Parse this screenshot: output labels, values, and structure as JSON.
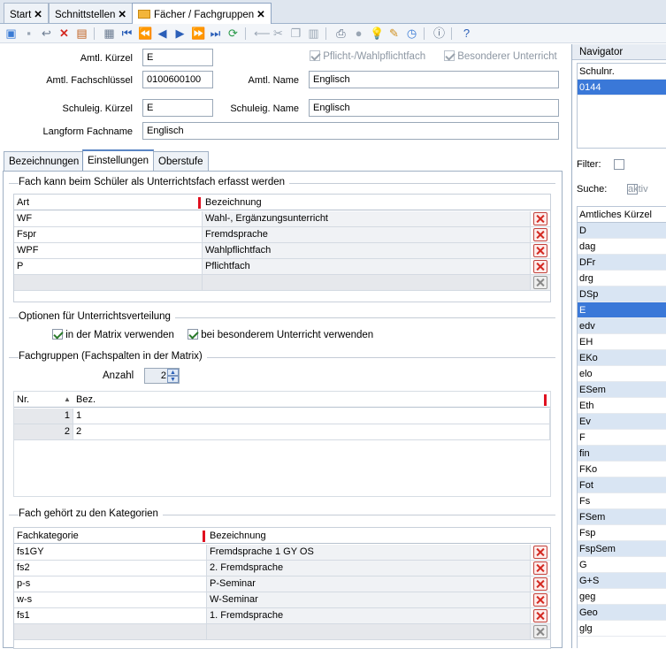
{
  "tabs": [
    {
      "label": "Start",
      "close": "✕"
    },
    {
      "label": "Schnittstellen",
      "close": "✕"
    },
    {
      "label": "Fächer / Fachgruppen",
      "close": "✕"
    }
  ],
  "form": {
    "amtl_kuerzel_label": "Amtl. Kürzel",
    "amtl_kuerzel": "E",
    "amtl_schluessel_label": "Amtl.  Fachschlüssel",
    "amtl_schluessel": "0100600100",
    "amtl_name_label": "Amtl. Name",
    "amtl_name": "Englisch",
    "schul_kuerzel_label": "Schuleig. Kürzel",
    "schul_kuerzel": "E",
    "schul_name_label": "Schuleig. Name",
    "schul_name": "Englisch",
    "langform_label": "Langform Fachname",
    "langform": "Englisch",
    "pflicht_wahl": "Pflicht-/Wahlpflichtfach",
    "besonderer": "Besonderer Unterricht"
  },
  "inner_tabs": [
    "Bezeichnungen",
    "Einstellungen",
    "Oberstufe"
  ],
  "section1": {
    "title": "Fach kann beim Schüler als Unterrichtsfach erfasst werden",
    "headers": [
      "Art",
      "Bezeichnung"
    ],
    "rows": [
      {
        "art": "WF",
        "bez": "Wahl-, Ergänzungsunterricht"
      },
      {
        "art": "Fspr",
        "bez": "Fremdsprache"
      },
      {
        "art": "WPF",
        "bez": "Wahlpflichtfach"
      },
      {
        "art": "P",
        "bez": "Pflichtfach"
      }
    ]
  },
  "section2": {
    "title": "Optionen für Unterrichtsverteilung",
    "opt1": "in der Matrix verwenden",
    "opt2": "bei besonderem Unterricht verwenden"
  },
  "section3": {
    "title": "Fachgruppen (Fachspalten in der Matrix)",
    "anzahl_label": "Anzahl",
    "anzahl": "2",
    "headers": [
      "Nr.",
      "Bez."
    ],
    "rows": [
      {
        "nr": "1",
        "bez": "1"
      },
      {
        "nr": "2",
        "bez": "2"
      }
    ]
  },
  "section4": {
    "title": "Fach gehört zu den Kategorien",
    "headers": [
      "Fachkategorie",
      "Bezeichnung"
    ],
    "rows": [
      {
        "kat": "fs1GY",
        "bez": "Fremdsprache 1 GY OS"
      },
      {
        "kat": "fs2",
        "bez": "2. Fremdsprache"
      },
      {
        "kat": "p-s",
        "bez": "P-Seminar"
      },
      {
        "kat": "w-s",
        "bez": "W-Seminar"
      },
      {
        "kat": "fs1",
        "bez": "1. Fremdsprache"
      }
    ]
  },
  "navigator": {
    "title": "Navigator",
    "schulnr_label": "Schulnr.",
    "schulnr": "0144",
    "filter_label": "Filter:",
    "suche_label": "Suche:",
    "aktiv_label": "aktiv",
    "list_header": "Amtliches Kürzel",
    "items": [
      "D",
      "dag",
      "DFr",
      "drg",
      "DSp",
      "E",
      "edv",
      "EH",
      "EKo",
      "elo",
      "ESem",
      "Eth",
      "Ev",
      "F",
      "fin",
      "FKo",
      "Fot",
      "Fs",
      "FSem",
      "Fsp",
      "FspSem",
      "G",
      "G+S",
      "geg",
      "Geo",
      "glg"
    ],
    "selected": "E"
  }
}
